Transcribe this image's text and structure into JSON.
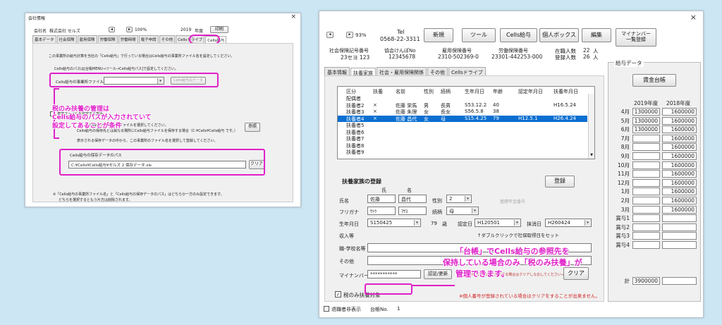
{
  "left": {
    "title": "会社情報",
    "close": "×",
    "company_label": "会社名",
    "company_name": "株式会社 セルズ",
    "zoom": "100%",
    "nav_prev": "◂",
    "nav_next": "▸",
    "year": "2019",
    "year_unit": "年度",
    "print": "印刷",
    "tabs": [
      "基本データ",
      "社会保険",
      "雇用保険",
      "労働保険",
      "労働時間",
      "電子申請",
      "その他",
      "Cellsドライブ",
      "Cells給与"
    ],
    "desc": "この事業所の給与計算を当社の「Cells給与」で行っている場合はCells給与の事業所ファイル名を設定してください。",
    "path_hint": "Cells給与のパスは[台帳MENU→ツール→Cells給与パス]で設定してください。",
    "file_label": "Cells給与の事業所ファイル名",
    "fetch_btn": "Cells給与のデータ",
    "direct_chk": "直接ファイルを指定する場合",
    "direct_line1": "Cells給与の事業所ファイルを選択してください。",
    "direct_line2": "Cells給与の保存先とは異なる場所にCells給与ファイルを保存する場合（C:¥Cells¥Cells給与 です。）",
    "direct_line3": "表示される保存データの中から、この事業所のファイル名を選択して登録してください。",
    "browse_btn": "参照",
    "save_label": "Cells給与の保存データのパス",
    "save_path": "C:¥Cells¥Cells給与¥セルズ 2 保存データ.xls",
    "clear_btn": "クリア",
    "note1": "※「Cells給与の事業所ファイル名」と「Cells給与の保存データのパス」はどちらか一方のみ設定できます。",
    "note2": "どちらを選択するともう片方は削除されます。",
    "callout1": "税のみ扶養の管理は",
    "callout2": "Cells給与のパスが入力されていて",
    "callout3": "設定してあることが条件"
  },
  "right": {
    "close": "×",
    "nav_prev": "◂",
    "nav_next": "▸",
    "zoom": "93%",
    "tel_label": "Tel",
    "tel": "0568-22-3311",
    "btn_new": "新規",
    "btn_tool": "ツール",
    "btn_cells": "Cells給与",
    "btn_box": "個人ボックス",
    "btn_edit": "編集",
    "btn_mynum1": "マイナンバー",
    "btn_mynum2": "一覧登録",
    "ins_label": "社会保険記号番号",
    "ins_val": "23セヨ 123",
    "kyokai_label": "協会けんぽNo",
    "kyokai_val": "12345678",
    "koyo_label": "雇用保険番号",
    "koyo_val": "2310-502369-0",
    "rodo_label": "労働保険番号",
    "rodo_val": "23301-442253-000",
    "zaishoku_label": "在職人数",
    "zaishoku_val": "22",
    "touroku_label": "登録人数",
    "touroku_val": "26",
    "ninzu_unit": "人",
    "tabs": [
      "基本情報",
      "扶養家族",
      "社会・雇用保険関係",
      "その他",
      "Cellsドライブ"
    ],
    "list_headers": [
      "区分",
      "扶養",
      "名前",
      "性別",
      "続柄",
      "生年月日",
      "年齢",
      "認定年月日",
      "扶養年月日"
    ],
    "list_rows": [
      [
        "配偶者",
        "",
        "",
        "",
        "",
        "",
        "",
        "",
        ""
      ],
      [
        "扶養者2",
        "×",
        "佐藤 栄馬",
        "男",
        "長男",
        "S53.12.2",
        "40",
        "",
        "H16.5.24"
      ],
      [
        "扶養者3",
        "×",
        "佐藤 朱理",
        "女",
        "長女",
        "S56.5.8",
        "38",
        "",
        ""
      ],
      [
        "扶養者4",
        "×",
        "佐藤 昌代",
        "女",
        "母",
        "S15.4.25",
        "79",
        "H12.5.1",
        "H26.4.24"
      ],
      [
        "扶養者5",
        "",
        "",
        "",
        "",
        "",
        "",
        "",
        ""
      ],
      [
        "扶養者6",
        "",
        "",
        "",
        "",
        "",
        "",
        "",
        ""
      ],
      [
        "扶養者7",
        "",
        "",
        "",
        "",
        "",
        "",
        "",
        ""
      ],
      [
        "扶養者8",
        "",
        "",
        "",
        "",
        "",
        "",
        "",
        ""
      ],
      [
        "扶養者9",
        "",
        "",
        "",
        "",
        "",
        "",
        "",
        ""
      ]
    ],
    "reg_title": "扶養家族の登録",
    "reg_btn": "登録",
    "last_lbl": "氏",
    "first_lbl": "名",
    "name_lbl": "氏名",
    "last_name": "佐藤",
    "first_name": "昌代",
    "furi_lbl": "フリガナ",
    "furi_last": "ｻﾄｳ",
    "furi_first": "ﾏｻﾖ",
    "sex_lbl": "性別",
    "sex_val": "2",
    "kiso": "基礎年金番号",
    "rel_lbl": "続柄",
    "rel_val": "母",
    "birth_lbl": "生年月日",
    "birth_val": "S150425",
    "age_val": "79",
    "age_unit": "歳",
    "nintei_lbl": "認定日",
    "nintei_val": "H120501",
    "soshitsu_lbl": "抹消日",
    "soshitsu_val": "H260424",
    "dbl_hint": "↑ダブルクリックで社保取得日をセット",
    "income_lbl": "収入等",
    "school_lbl": "職-学校名等",
    "other_lbl": "その他",
    "mynum_lbl": "マイナンバー",
    "mynum_val": "***********",
    "auth_btn": "認証/更新",
    "clear_btn": "クリア",
    "small_note": "※扶養者が既に別の人に変更する場合はクリアしなおしてください⇒⇒⇒",
    "tax_chk": "税のみ扶養対象",
    "warn": "※個人番号が登録されている場合はクリアをすることが出来ません。",
    "foot_chk": "退職者非表示",
    "foot_no_lbl": "台帳No.",
    "foot_no": "1",
    "callout1": "「台帳」でCells給与の参照先を",
    "callout2": "保持している場合のみ「税のみ扶養」が",
    "callout3": "管理できます。",
    "pay_group": "給与データ",
    "pay_btn": "賃金台帳",
    "pay_y1": "2019年度",
    "pay_y2": "2018年度",
    "pay_rows": [
      [
        "4月",
        "1300000",
        "1600000"
      ],
      [
        "5月",
        "1300000",
        "1600000"
      ],
      [
        "6月",
        "1300000",
        "1600000"
      ],
      [
        "7月",
        "",
        "1600000"
      ],
      [
        "8月",
        "",
        "1600000"
      ],
      [
        "9月",
        "",
        "1600000"
      ],
      [
        "10月",
        "",
        "1600000"
      ],
      [
        "11月",
        "",
        "1600000"
      ],
      [
        "12月",
        "",
        "1600000"
      ],
      [
        "1月",
        "",
        "1600000"
      ],
      [
        "2月",
        "",
        "1600000"
      ],
      [
        "3月",
        "",
        "1600000"
      ],
      [
        "賞与1",
        "",
        ""
      ],
      [
        "賞与2",
        "",
        ""
      ],
      [
        "賞与3",
        "",
        ""
      ],
      [
        "賞与4",
        "",
        ""
      ]
    ],
    "total_lbl": "計",
    "total_a": "3900000",
    "total_b": ""
  }
}
